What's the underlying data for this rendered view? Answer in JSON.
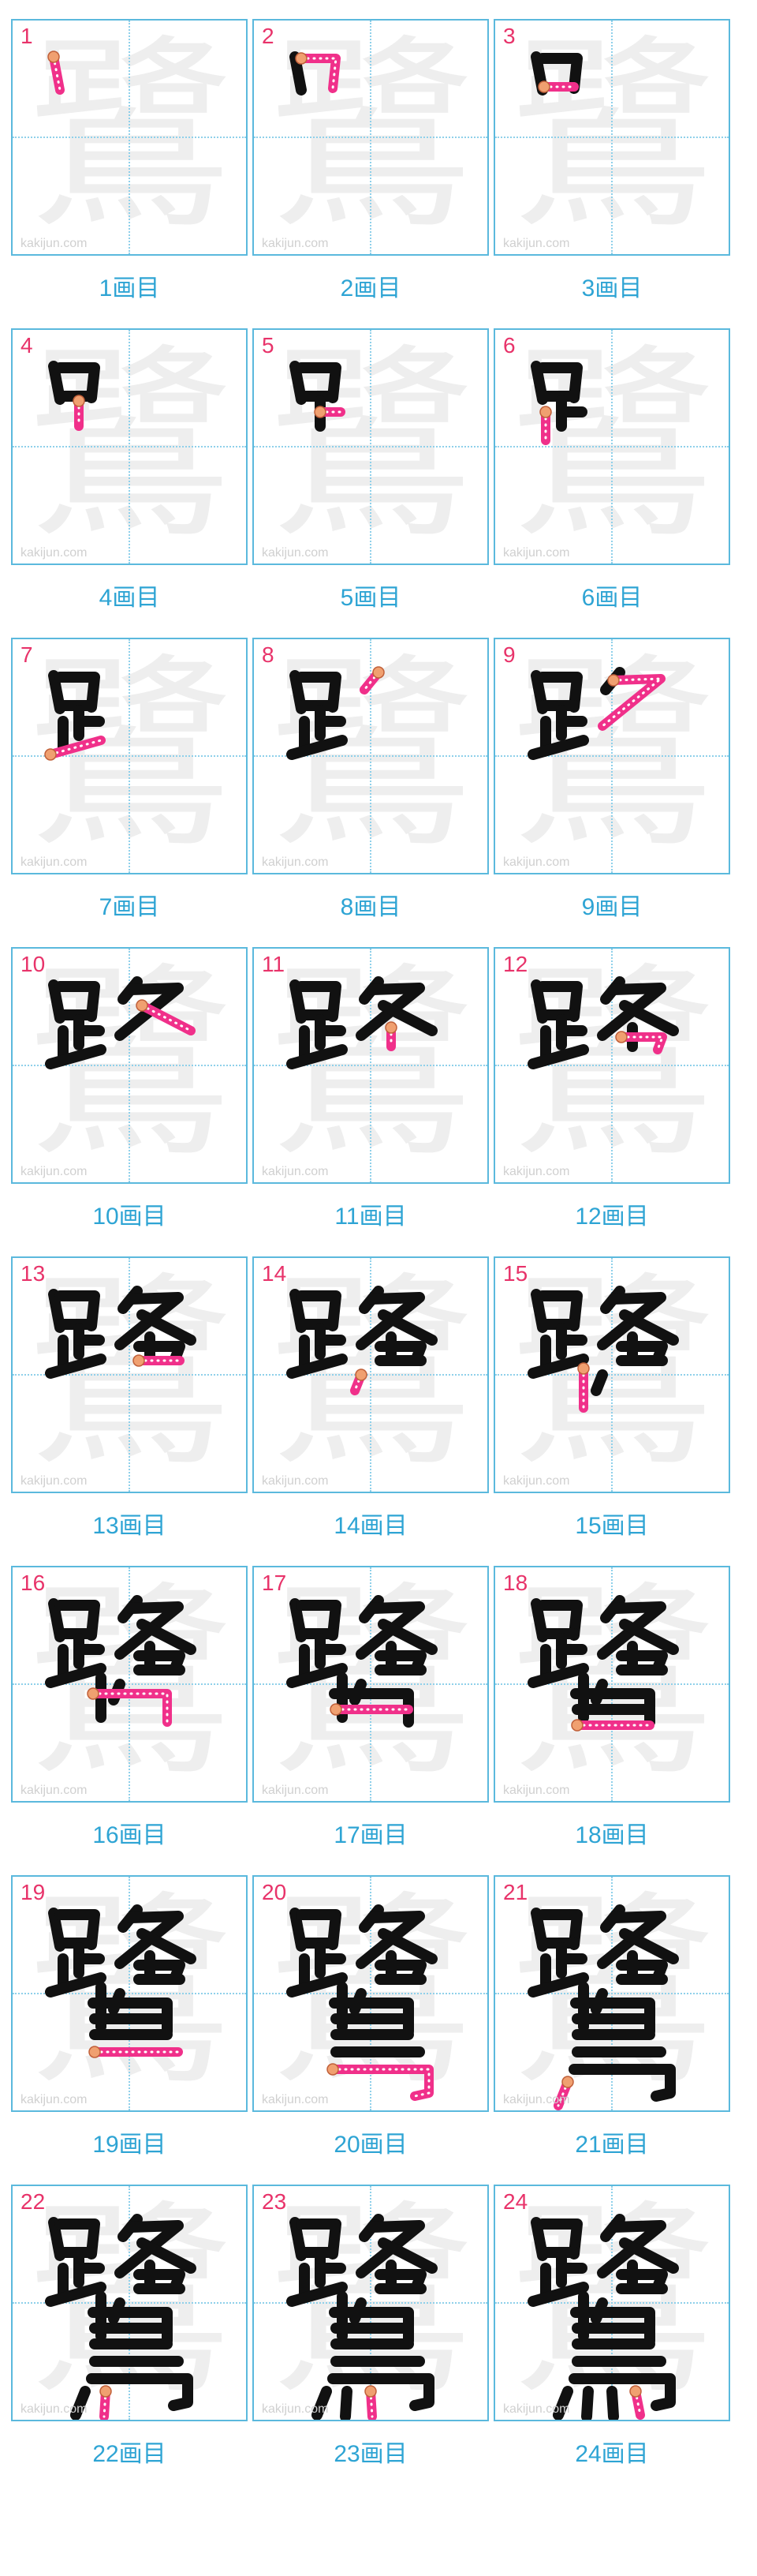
{
  "watermark": "kakijun.com",
  "ghost_char": "鷺",
  "cells": [
    {
      "num": "1",
      "label": "1画目"
    },
    {
      "num": "2",
      "label": "2画目"
    },
    {
      "num": "3",
      "label": "3画目"
    },
    {
      "num": "4",
      "label": "4画目"
    },
    {
      "num": "5",
      "label": "5画目"
    },
    {
      "num": "6",
      "label": "6画目"
    },
    {
      "num": "7",
      "label": "7画目"
    },
    {
      "num": "8",
      "label": "8画目"
    },
    {
      "num": "9",
      "label": "9画目"
    },
    {
      "num": "10",
      "label": "10画目"
    },
    {
      "num": "11",
      "label": "11画目"
    },
    {
      "num": "12",
      "label": "12画目"
    },
    {
      "num": "13",
      "label": "13画目"
    },
    {
      "num": "14",
      "label": "14画目"
    },
    {
      "num": "15",
      "label": "15画目"
    },
    {
      "num": "16",
      "label": "16画目"
    },
    {
      "num": "17",
      "label": "17画目"
    },
    {
      "num": "18",
      "label": "18画目"
    },
    {
      "num": "19",
      "label": "19画目"
    },
    {
      "num": "20",
      "label": "20画目"
    },
    {
      "num": "21",
      "label": "21画目"
    },
    {
      "num": "22",
      "label": "22画目"
    },
    {
      "num": "23",
      "label": "23画目"
    },
    {
      "num": "24",
      "label": "24画目"
    }
  ],
  "colors": {
    "border": "#5bb9dd",
    "guide": "#8fd0ea",
    "number": "#e8336a",
    "label": "#2ea4d4",
    "ghost": "#eeeeee",
    "done_stroke": "#111111",
    "current_stroke": "#f0308a",
    "start_dot": "#f0a070"
  }
}
